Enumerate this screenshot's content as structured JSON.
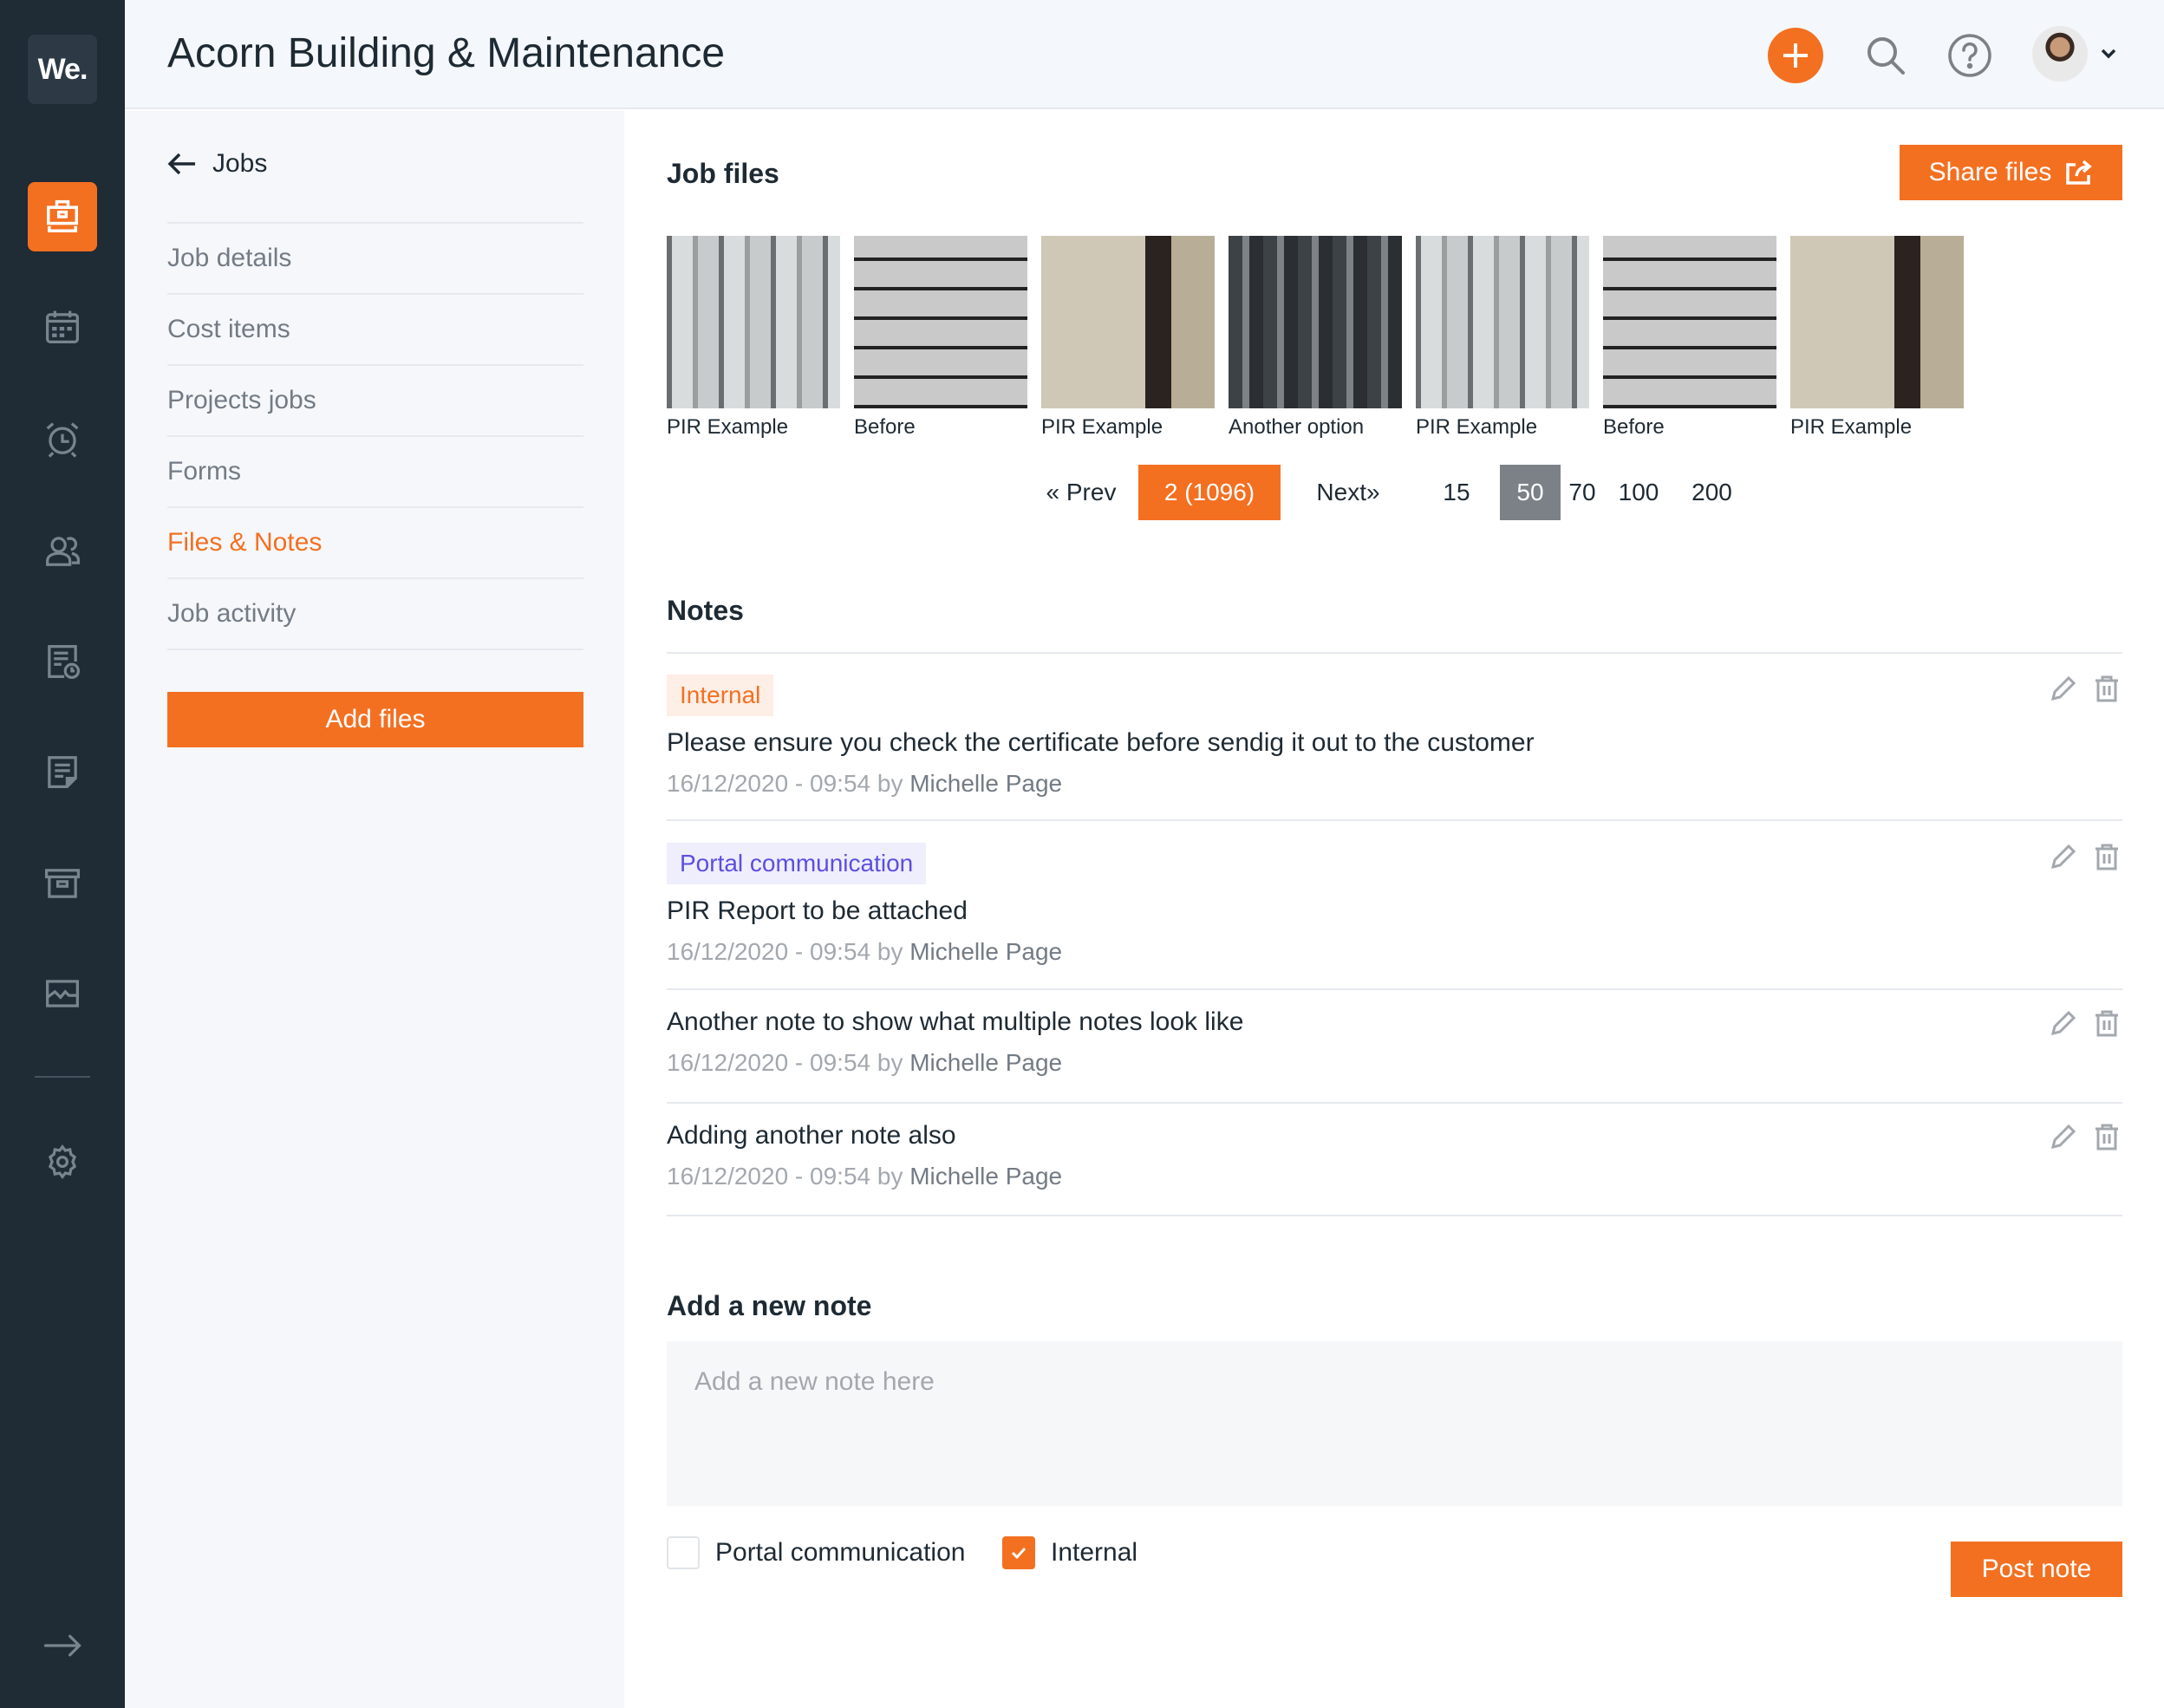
{
  "app": {
    "logo_text": "We.",
    "title": "Acorn Building & Maintenance"
  },
  "sidebar": {
    "items": [
      {
        "name": "jobs",
        "icon": "briefcase-icon",
        "active": true
      },
      {
        "name": "calendar",
        "icon": "calendar-icon",
        "active": false
      },
      {
        "name": "reminders",
        "icon": "alarm-clock-icon",
        "active": false
      },
      {
        "name": "contacts",
        "icon": "users-icon",
        "active": false
      },
      {
        "name": "timesheets",
        "icon": "document-clock-icon",
        "active": false
      },
      {
        "name": "notes",
        "icon": "note-icon",
        "active": false
      },
      {
        "name": "archive",
        "icon": "archive-box-icon",
        "active": false
      },
      {
        "name": "reports",
        "icon": "activity-chart-icon",
        "active": false
      },
      {
        "name": "settings",
        "icon": "gear-icon",
        "active": false
      }
    ],
    "expand_icon": "arrow-right-icon"
  },
  "header": {
    "add_icon": "plus-icon",
    "search_icon": "search-icon",
    "help_icon": "help-circle-icon",
    "avatar": "user-avatar",
    "menu_icon": "chevron-down-icon"
  },
  "subnav": {
    "back_label": "Jobs",
    "items": [
      {
        "label": "Job details",
        "active": false
      },
      {
        "label": "Cost items",
        "active": false
      },
      {
        "label": "Projects jobs",
        "active": false
      },
      {
        "label": "Forms",
        "active": false
      },
      {
        "label": "Files & Notes",
        "active": true
      },
      {
        "label": "Job activity",
        "active": false
      }
    ],
    "add_files_label": "Add files"
  },
  "job_files": {
    "title": "Job files",
    "share_label": "Share files",
    "files": [
      {
        "label": "PIR Example",
        "image": "white-pipes"
      },
      {
        "label": "Before",
        "image": "pipes-gas-meter"
      },
      {
        "label": "PIR Example",
        "image": "tiled-utility-room"
      },
      {
        "label": "Another option",
        "image": "dark-meter-bank"
      },
      {
        "label": "PIR Example",
        "image": "white-pipes"
      },
      {
        "label": "Before",
        "image": "pipes-gas-meter"
      },
      {
        "label": "PIR Example",
        "image": "tiled-utility-room"
      }
    ],
    "pagination": {
      "prev_label": "« Prev",
      "current_label": "2 (1096)",
      "next_label": "Next»",
      "page_sizes": [
        "15",
        "50",
        "70",
        "100",
        "200"
      ],
      "selected_page_size": "50"
    }
  },
  "notes": {
    "title": "Notes",
    "items": [
      {
        "badge": "Internal",
        "badge_type": "internal",
        "text": "Please ensure you check the certificate before sendig it out to the customer",
        "date": "16/12/2020 - 09:54",
        "by": "by",
        "author": "Michelle Page"
      },
      {
        "badge": "Portal communication",
        "badge_type": "portal",
        "text": "PIR Report to be attached",
        "date": "16/12/2020 - 09:54",
        "by": "by",
        "author": "Michelle Page"
      },
      {
        "badge": null,
        "text": "Another note to show what multiple notes look like",
        "date": "16/12/2020 - 09:54",
        "by": "by",
        "author": "Michelle Page"
      },
      {
        "badge": null,
        "text": "Adding another note also",
        "date": "16/12/2020 - 09:54",
        "by": "by",
        "author": "Michelle Page"
      }
    ]
  },
  "new_note": {
    "title": "Add a new note",
    "placeholder": "Add a new note here",
    "value": "",
    "portal_label": "Portal communication",
    "portal_checked": false,
    "internal_label": "Internal",
    "internal_checked": true,
    "post_label": "Post note"
  },
  "colors": {
    "accent": "#f37021",
    "sidebar_bg": "#1f2b35",
    "portal_badge": "#5b4fe0",
    "selected_size_bg": "#7c8187"
  }
}
